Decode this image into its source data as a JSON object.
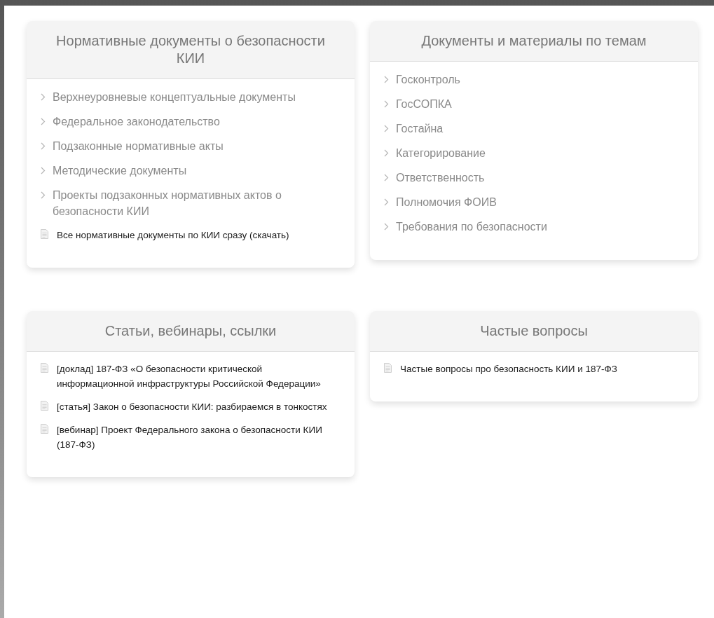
{
  "cards": [
    {
      "title": "Нормативные документы о безопасности КИИ",
      "items": [
        {
          "kind": "category",
          "label": "Верхнеуровневые концептуальные документы"
        },
        {
          "kind": "category",
          "label": "Федеральное законодательство"
        },
        {
          "kind": "category",
          "label": "Подзаконные нормативные акты"
        },
        {
          "kind": "category",
          "label": "Методические документы"
        },
        {
          "kind": "category",
          "label": "Проекты подзаконных нормативных актов о безопасности КИИ"
        },
        {
          "kind": "document",
          "label": "Все нормативные документы по КИИ сразу (скачать)"
        }
      ]
    },
    {
      "title": "Документы и материалы по темам",
      "items": [
        {
          "kind": "category",
          "label": "Госконтроль"
        },
        {
          "kind": "category",
          "label": "ГосСОПКА"
        },
        {
          "kind": "category",
          "label": "Гостайна"
        },
        {
          "kind": "category",
          "label": "Категорирование"
        },
        {
          "kind": "category",
          "label": "Ответственность"
        },
        {
          "kind": "category",
          "label": "Полномочия ФОИВ"
        },
        {
          "kind": "category",
          "label": "Требования по безопасности"
        }
      ]
    },
    {
      "title": "Статьи, вебинары, ссылки",
      "items": [
        {
          "kind": "document",
          "label": "[доклад] 187-ФЗ «О безопасности критической информационной инфраструктуры Российской Федерации»"
        },
        {
          "kind": "document",
          "label": "[статья] Закон о безопасности КИИ: разбираемся в тонкостях"
        },
        {
          "kind": "document",
          "label": "[вебинар] Проект Федерального закона о безопасности КИИ (187-ФЗ)"
        }
      ]
    },
    {
      "title": "Частые вопросы",
      "items": [
        {
          "kind": "document",
          "label": "Частые вопросы про безопасность КИИ и 187-ФЗ"
        }
      ]
    }
  ]
}
